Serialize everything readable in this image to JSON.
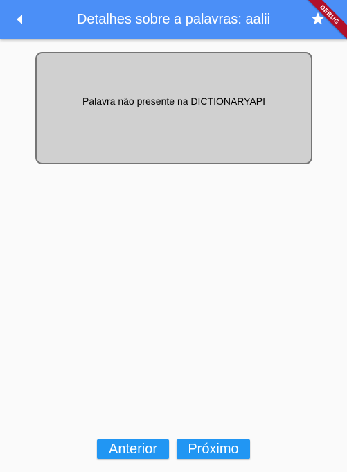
{
  "app_bar": {
    "title": "Detalhes sobre a palavras: aalii",
    "back_icon": "arrow-back-icon",
    "favorite_icon": "star-icon",
    "color": "#4b8ff7"
  },
  "debug_banner": {
    "label": "DEBUG",
    "color": "#b0102a"
  },
  "card": {
    "message": "Palavra não presente na DICTIONARYAPI",
    "background": "#d0d0d0"
  },
  "navigation": {
    "prev_label": "Anterior",
    "next_label": "Próximo",
    "button_color": "#2196f3"
  }
}
